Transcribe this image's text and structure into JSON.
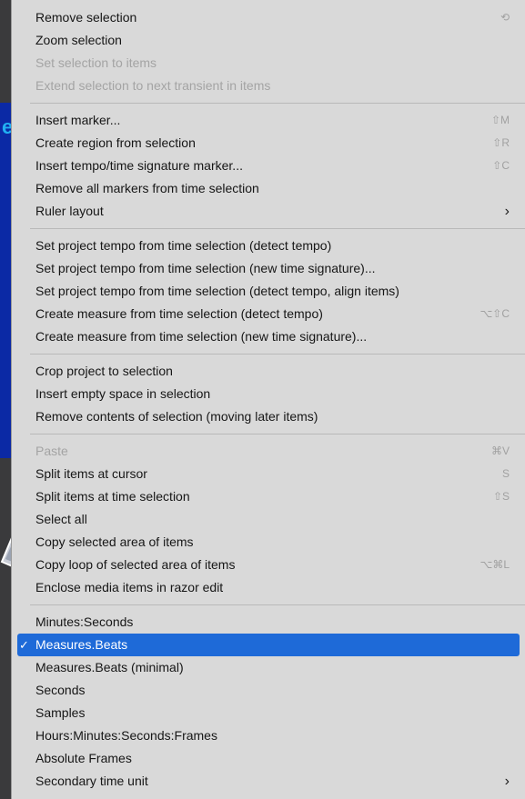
{
  "annotation": {
    "peek_text": "e"
  },
  "menu": {
    "groups": [
      [
        {
          "label": "Remove selection",
          "shortcut": "⟲",
          "disabled": false
        },
        {
          "label": "Zoom selection",
          "shortcut": "",
          "disabled": false
        },
        {
          "label": "Set selection to items",
          "shortcut": "",
          "disabled": true
        },
        {
          "label": "Extend selection to next transient in items",
          "shortcut": "",
          "disabled": true
        }
      ],
      [
        {
          "label": "Insert marker...",
          "shortcut": "⇧M",
          "disabled": false
        },
        {
          "label": "Create region from selection",
          "shortcut": "⇧R",
          "disabled": false
        },
        {
          "label": "Insert tempo/time signature marker...",
          "shortcut": "⇧C",
          "disabled": false
        },
        {
          "label": "Remove all markers from time selection",
          "shortcut": "",
          "disabled": false
        },
        {
          "label": "Ruler layout",
          "shortcut": "",
          "submenu": "›",
          "disabled": false
        }
      ],
      [
        {
          "label": "Set project tempo from time selection (detect tempo)",
          "shortcut": "",
          "disabled": false
        },
        {
          "label": "Set project tempo from time selection (new time signature)...",
          "shortcut": "",
          "disabled": false
        },
        {
          "label": "Set project tempo from time selection (detect tempo, align items)",
          "shortcut": "",
          "disabled": false
        },
        {
          "label": "Create measure from time selection (detect tempo)",
          "shortcut": "⌥⇧C",
          "disabled": false
        },
        {
          "label": "Create measure from time selection (new time signature)...",
          "shortcut": "",
          "disabled": false
        }
      ],
      [
        {
          "label": "Crop project to selection",
          "shortcut": "",
          "disabled": false
        },
        {
          "label": "Insert empty space in selection",
          "shortcut": "",
          "disabled": false
        },
        {
          "label": "Remove contents of selection (moving later items)",
          "shortcut": "",
          "disabled": false
        }
      ],
      [
        {
          "label": "Paste",
          "shortcut": "⌘V",
          "disabled": true
        },
        {
          "label": "Split items at cursor",
          "shortcut": "S",
          "disabled": false
        },
        {
          "label": "Split items at time selection",
          "shortcut": "⇧S",
          "disabled": false
        },
        {
          "label": "Select all",
          "shortcut": "",
          "disabled": false
        },
        {
          "label": "Copy selected area of items",
          "shortcut": "",
          "disabled": false
        },
        {
          "label": "Copy loop of selected area of items",
          "shortcut": "⌥⌘L",
          "disabled": false
        },
        {
          "label": "Enclose media items in razor edit",
          "shortcut": "",
          "disabled": false
        }
      ],
      [
        {
          "label": "Minutes:Seconds",
          "shortcut": "",
          "disabled": false
        },
        {
          "label": "Measures.Beats",
          "shortcut": "",
          "checked": true,
          "check": "✓",
          "disabled": false
        },
        {
          "label": "Measures.Beats (minimal)",
          "shortcut": "",
          "disabled": false
        },
        {
          "label": "Seconds",
          "shortcut": "",
          "disabled": false
        },
        {
          "label": "Samples",
          "shortcut": "",
          "disabled": false
        },
        {
          "label": "Hours:Minutes:Seconds:Frames",
          "shortcut": "",
          "disabled": false
        },
        {
          "label": "Absolute Frames",
          "shortcut": "",
          "disabled": false
        },
        {
          "label": "Secondary time unit",
          "shortcut": "",
          "submenu": "›",
          "disabled": false
        }
      ]
    ]
  },
  "colors": {
    "menu_bg": "#d9d9d9",
    "highlight": "#1e6ad8",
    "annotation_blue": "#0b29a5",
    "annotation_text": "#21b0f3"
  }
}
